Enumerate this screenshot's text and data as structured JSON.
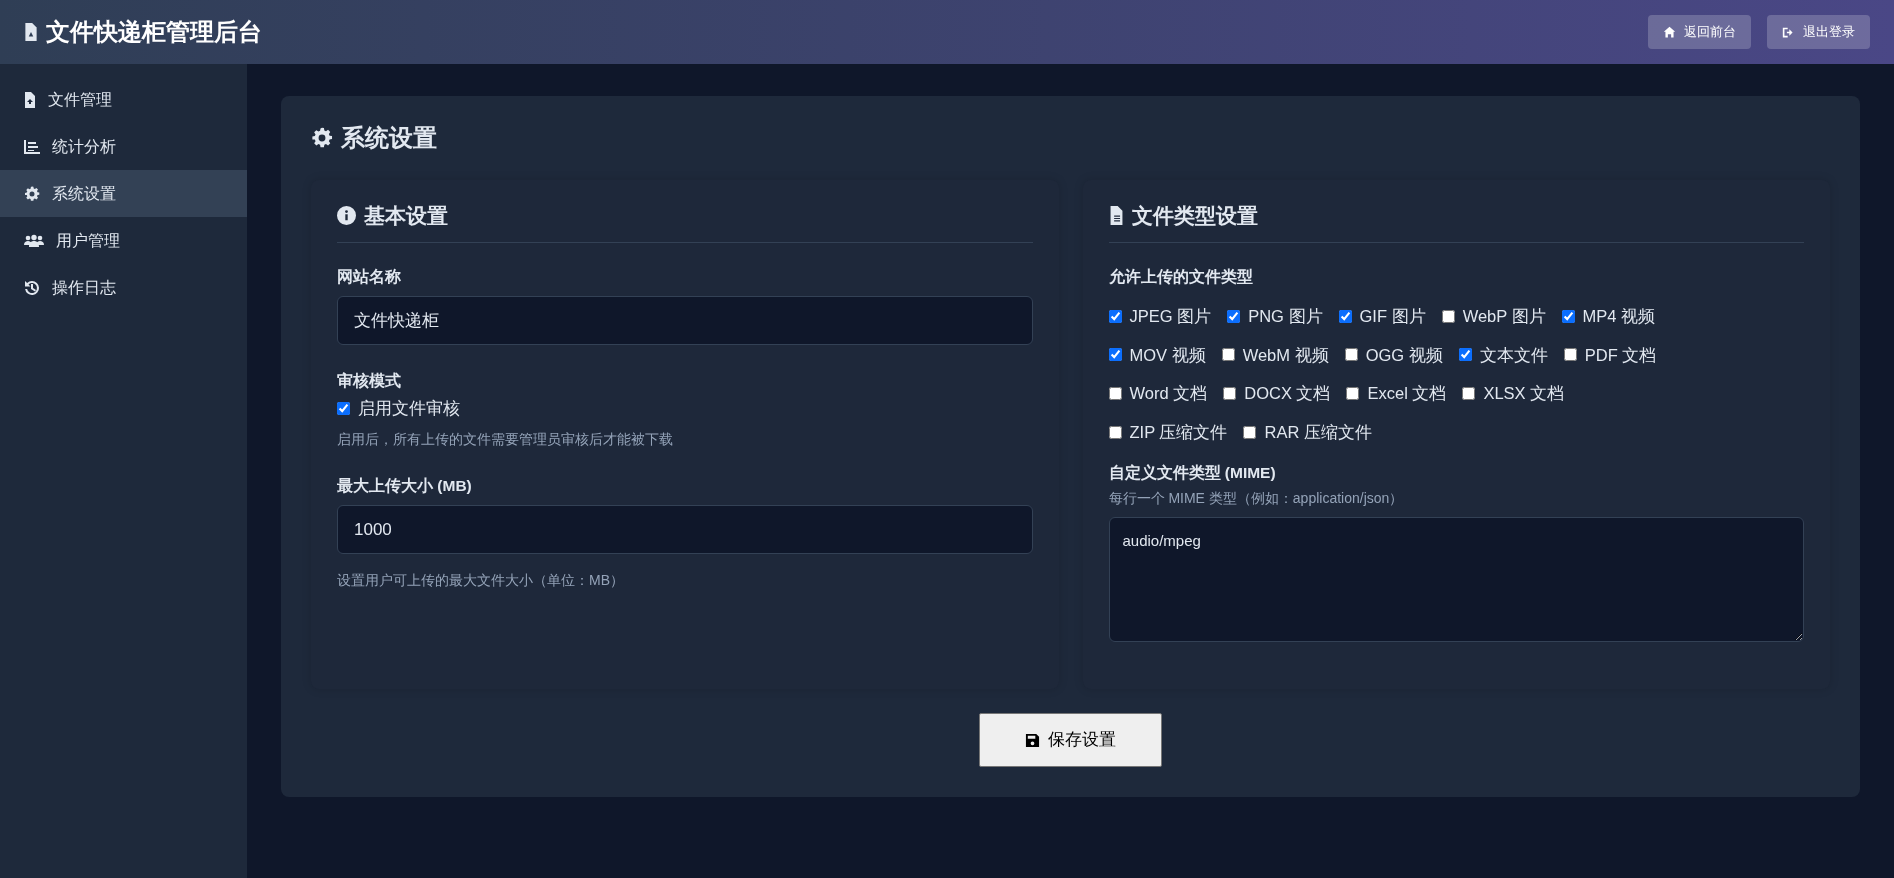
{
  "header": {
    "title": "文件快递柜管理后台",
    "buttons": [
      "返回前台",
      "退出登录"
    ]
  },
  "sidebar": {
    "items": [
      {
        "label": "文件管理",
        "selected": false
      },
      {
        "label": "统计分析",
        "selected": false
      },
      {
        "label": "系统设置",
        "selected": true
      },
      {
        "label": "用户管理",
        "selected": false
      },
      {
        "label": "操作日志",
        "selected": false
      }
    ]
  },
  "page_title": "系统设置",
  "basic": {
    "title": "基本设置",
    "site_name": {
      "label": "网站名称",
      "value": "文件快递柜"
    },
    "review": {
      "label": "审核模式",
      "checkbox": "启用文件审核",
      "checked": true,
      "help": "启用后，所有上传的文件需要管理员审核后才能被下载"
    },
    "max_size": {
      "label": "最大上传大小 (MB)",
      "value": "1000",
      "help": "设置用户可上传的最大文件大小（单位：MB）"
    }
  },
  "file_types": {
    "title": "文件类型设置",
    "allowed_label": "允许上传的文件类型",
    "types": [
      {
        "label": "JPEG 图片",
        "checked": true
      },
      {
        "label": "PNG 图片",
        "checked": true
      },
      {
        "label": "GIF 图片",
        "checked": true
      },
      {
        "label": "WebP 图片",
        "checked": false
      },
      {
        "label": "MP4 视频",
        "checked": true
      },
      {
        "label": "MOV 视频",
        "checked": true
      },
      {
        "label": "WebM 视频",
        "checked": false
      },
      {
        "label": "OGG 视频",
        "checked": false
      },
      {
        "label": "文本文件",
        "checked": true
      },
      {
        "label": "PDF 文档",
        "checked": false
      },
      {
        "label": "Word 文档",
        "checked": false
      },
      {
        "label": "DOCX 文档",
        "checked": false
      },
      {
        "label": "Excel 文档",
        "checked": false
      },
      {
        "label": "XLSX 文档",
        "checked": false
      },
      {
        "label": "ZIP 压缩文件",
        "checked": false
      },
      {
        "label": "RAR 压缩文件",
        "checked": false
      }
    ],
    "custom": {
      "label": "自定义文件类型 (MIME)",
      "help": "每行一个 MIME 类型（例如：application/json）",
      "value": "audio/mpeg"
    }
  },
  "save_button": "保存设置"
}
